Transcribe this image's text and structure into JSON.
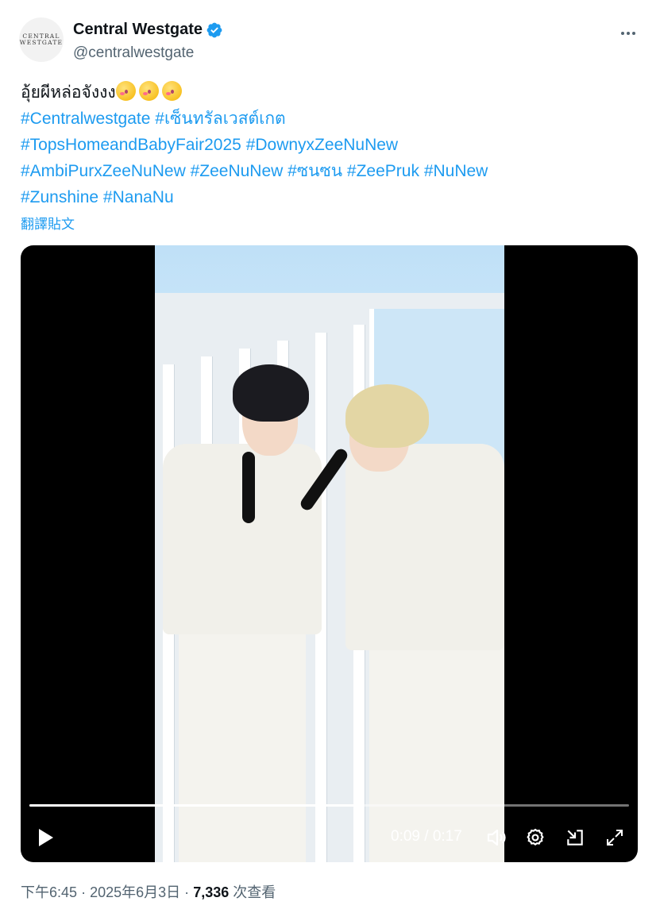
{
  "account": {
    "display_name": "Central Westgate",
    "handle": "@centralwestgate",
    "avatar_text_line1": "CENTRAL",
    "avatar_text_line2": "WESTGATE",
    "verified": true
  },
  "post": {
    "text_line1": "อุ้ยผีหล่อจังงง",
    "emoji_count": 3,
    "emoji_name": "kissing-face-emoji",
    "hashtag_lines": [
      [
        "#Centralwestgate",
        "#เซ็นทรัลเวสต์เกต"
      ],
      [
        "#TopsHomeandBabyFair2025",
        "#DownyxZeeNuNew"
      ],
      [
        "#AmbiPurxZeeNuNew",
        "#ZeeNuNew",
        "#ซนซน",
        "#ZeePruk",
        "#NuNew"
      ],
      [
        "#Zunshine",
        "#NanaNu"
      ]
    ],
    "translate_label": "翻譯貼文"
  },
  "video": {
    "time_current": "0:09",
    "time_separator": "/",
    "time_total": "0:17",
    "progress": 0.556,
    "icons": [
      "play-icon",
      "volume-icon",
      "settings-icon",
      "picture-in-picture-icon",
      "fullscreen-icon"
    ]
  },
  "meta": {
    "time": "下午6:45",
    "sep1": "·",
    "date": "2025年6月3日",
    "sep2": "·",
    "views_count": "7,336",
    "views_label": "次查看"
  },
  "colors": {
    "accent": "#1d9bf0",
    "text": "#0f1419",
    "secondary": "#536471"
  }
}
